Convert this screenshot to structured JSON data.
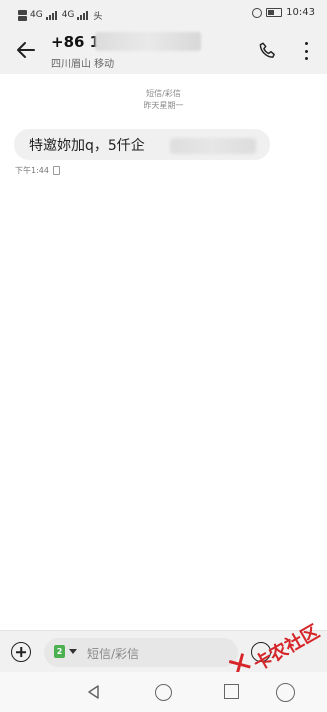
{
  "status_bar": {
    "network": "4G",
    "network2": "4G",
    "data_icon": "头",
    "time": "10:43"
  },
  "header": {
    "contact_number": "+86 1",
    "location": "四川眉山 移动",
    "back_icon": "arrow-left-icon",
    "call_icon": "phone-icon",
    "more_icon": "more-vertical-icon"
  },
  "conversation": {
    "message_type": "短信/彩信",
    "date": "昨天星期一",
    "messages": [
      {
        "text": "特邀妳加q，5仟企",
        "time": "下午1:44"
      }
    ]
  },
  "composer": {
    "sim_label": "2",
    "placeholder": "短信/彩信"
  },
  "watermark": {
    "text": "卡农社区"
  }
}
